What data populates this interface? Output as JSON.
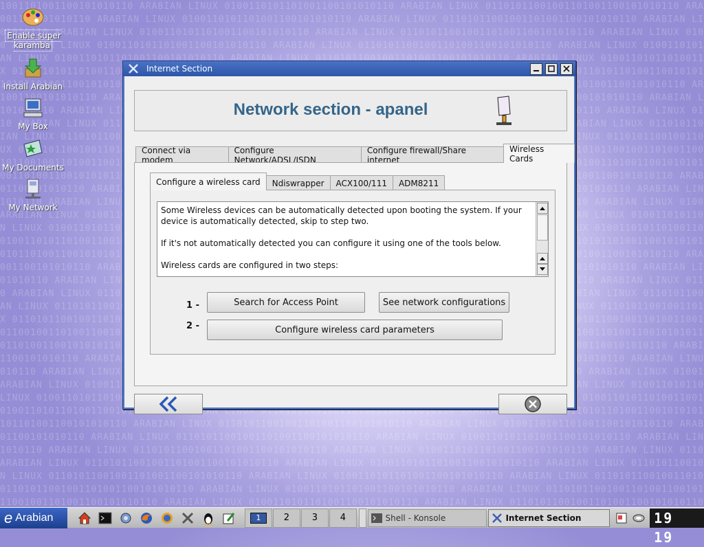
{
  "desktop": {
    "icons": [
      {
        "label": "Enable super karamba"
      },
      {
        "label": "Install Arabian"
      },
      {
        "label": "My Box"
      },
      {
        "label": "My Documents"
      },
      {
        "label": "My Network"
      }
    ],
    "background_text": "1001101001100101010110 ARABIAN LINUX 0100110101101001100101010110 ARABIAN LINUX 0110101100"
  },
  "window": {
    "title": "Internet Section",
    "banner_title": "Network section - apanel",
    "tabs": [
      {
        "label": "Connect via modem"
      },
      {
        "label": "Configure Network/ADSL/ISDN"
      },
      {
        "label": "Configure firewall/Share internet"
      },
      {
        "label": "Wireless Cards"
      }
    ],
    "inner_tabs": [
      {
        "label": "Configure a wireless card"
      },
      {
        "label": "Ndiswrapper"
      },
      {
        "label": "ACX100/111"
      },
      {
        "label": "ADM8211"
      }
    ],
    "description": [
      "Some Wireless devices can be automatically detected upon booting the system. If your device is automatically detected, skip to step two.",
      "If it's not automatically detected you can configure it using one of the tools below.",
      "Wireless cards are configured in two steps:"
    ],
    "steps": {
      "step1_label": "1 -",
      "step2_label": "2 -",
      "search_ap": "Search for Access Point",
      "see_configs": "See network configurations",
      "configure_params": "Configure wireless card parameters"
    }
  },
  "taskbar": {
    "start_label": "Arabian",
    "desktops": [
      "1",
      "2",
      "3",
      "4"
    ],
    "tasks": [
      {
        "label": "Shell - Konsole"
      },
      {
        "label": "Internet Section"
      }
    ],
    "clock": "19 19"
  }
}
